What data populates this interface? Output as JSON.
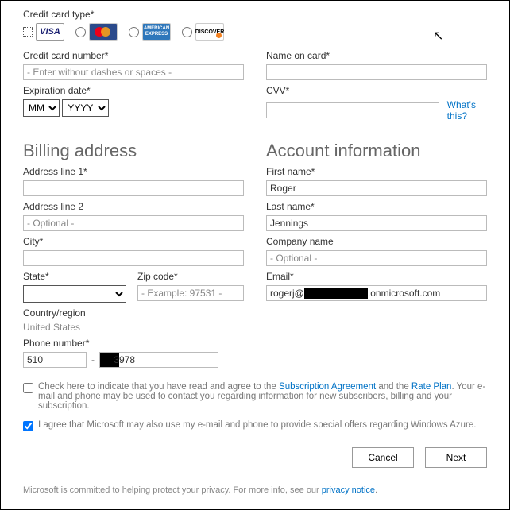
{
  "card": {
    "type_label": "Credit card type*",
    "options": {
      "visa": "VISA",
      "mc": "",
      "amex": "AMERICAN EXPRESS",
      "disc": "DISCOVER"
    },
    "number_label": "Credit card number*",
    "number_placeholder": "- Enter without dashes or spaces -",
    "exp_label": "Expiration date*",
    "exp_mm": "MM",
    "exp_yyyy": "YYYY",
    "name_label": "Name on card*",
    "cvv_label": "CVV*",
    "cvv_help": "What's this?"
  },
  "billing": {
    "heading": "Billing address",
    "addr1_label": "Address line 1*",
    "addr2_label": "Address line 2",
    "addr2_placeholder": "- Optional -",
    "city_label": "City*",
    "state_label": "State*",
    "zip_label": "Zip code*",
    "zip_placeholder": "- Example: 97531 -",
    "country_label": "Country/region",
    "country_value": "United States",
    "phone_label": "Phone number*",
    "phone_area": "510",
    "phone_suffix": "3978"
  },
  "account": {
    "heading": "Account information",
    "first_label": "First name*",
    "first_value": "Roger",
    "last_label": "Last name*",
    "last_value": "Jennings",
    "company_label": "Company name",
    "company_placeholder": "- Optional -",
    "email_label": "Email*",
    "email_prefix": "rogerj@",
    "email_domain": ".onmicrosoft.com"
  },
  "agree1_pre": "Check here to indicate that you have read and agree to the ",
  "agree1_link1": "Subscription Agreement",
  "agree1_mid": " and the ",
  "agree1_link2": "Rate Plan",
  "agree1_post": ". Your e-mail and phone may be used to contact you regarding information for new subscribers, billing and your subscription.",
  "agree2": "I agree that Microsoft may also use my e-mail and phone to provide special offers regarding Windows Azure.",
  "buttons": {
    "cancel": "Cancel",
    "next": "Next"
  },
  "footer_pre": "Microsoft is committed to helping protect your privacy. For more info, see our ",
  "footer_link": "privacy notice",
  "footer_post": "."
}
